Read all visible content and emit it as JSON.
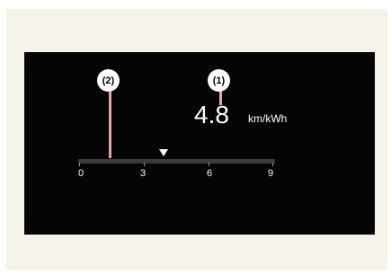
{
  "callouts": {
    "one": "(1)",
    "two": "(2)"
  },
  "display": {
    "value": "4.8",
    "unit": "km/kWh"
  },
  "scale": {
    "ticks": [
      "0",
      "3",
      "6",
      "9"
    ],
    "average_marker_value": 4
  },
  "colors": {
    "screen_background": "#050505",
    "panel_background": "#f5f2e9",
    "callout_line": "#e9a7ab"
  }
}
